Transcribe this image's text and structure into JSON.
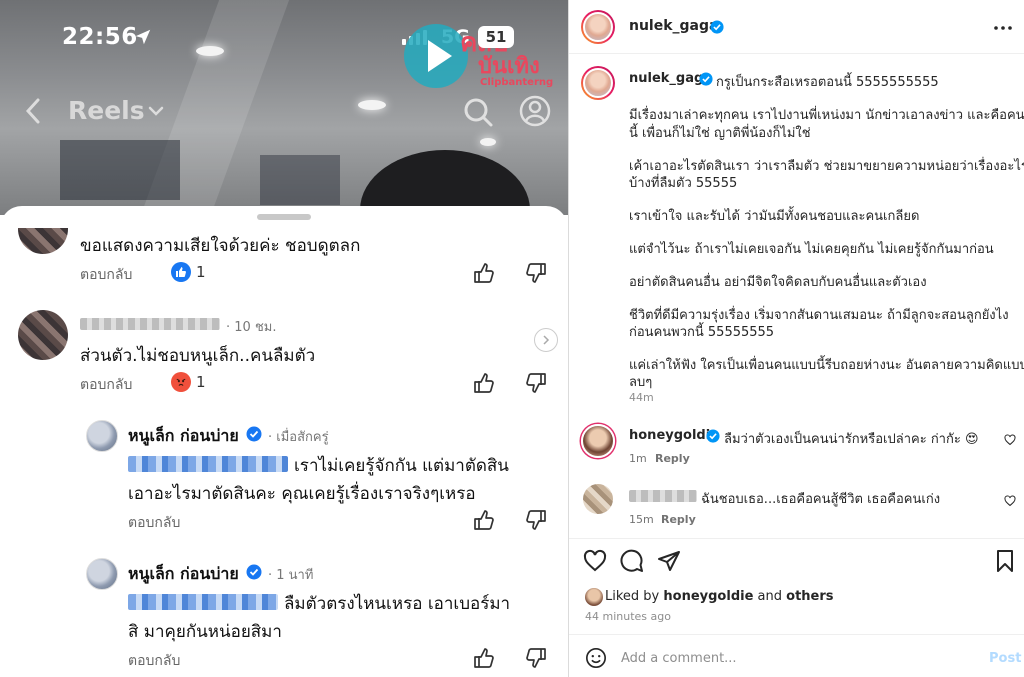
{
  "phone": {
    "status_time": "22:56",
    "network": "5G",
    "battery": "51",
    "watermark_title_1": "คลิป",
    "watermark_title_2": "บันเทิง",
    "watermark_sub": "Clipbanterng",
    "header_title": "Reels"
  },
  "comments": [
    {
      "text": "ขอแสดงความเสียใจด้วยค่ะ ชอบดูตลก",
      "reply_label": "ตอบกลับ",
      "reaction": "like",
      "reaction_count": "1"
    },
    {
      "time": "· 10 ชม.",
      "text": "ส่วนตัว.ไม่ชอบหนูเล็ก..คนลืมตัว",
      "reply_label": "ตอบกลับ",
      "reaction": "angry",
      "reaction_count": "1"
    }
  ],
  "replies": [
    {
      "name": "หนูเล็ก ก่อนบ่าย",
      "time": "· เมื่อสักครู่",
      "line1": "เราไม่เคยรู้จักกัน แต่มาตัดสิน",
      "line2": "เอาอะไรมาตัดสินคะ คุณเคยรู้เรื่องเราจริงๆเหรอ",
      "reply_label": "ตอบกลับ"
    },
    {
      "name": "หนูเล็ก ก่อนบ่าย",
      "time": "· 1 นาที",
      "line1": "ลืมตัวตรงไหนเหรอ เอาเบอร์มา",
      "line2": "สิ มาคุยกันหน่อยสิมา",
      "reply_label": "ตอบกลับ"
    }
  ],
  "post": {
    "username": "nulek_gaga",
    "caption_first": "กรูเป็นกระสือเหรอตอนนี้ 5555555555",
    "caption_lines": [
      "มีเรื่องมาเล่าคะทุกคน เราไปงานพี่เหน่งมา นักข่าวเอาลงข่าว และคือคนๆ",
      "นี้ เพื่อนก็ไม่ใช่ ญาติพี่น้องก็ไม่ใช่",
      "เค้าเอาอะไรตัดสินเรา ว่าเราลืมตัว ช่วยมาขยายความหน่อยว่าเรื่องอะไร",
      "บ้างที่ลืมตัว 55555",
      "เราเข้าใจ และรับได้ ว่ามันมีทั้งคนชอบและคนเกลียด",
      "แต่จำไว้นะ ถ้าเราไม่เคยเจอกัน ไม่เคยคุยกัน ไม่เคยรู้จักกันมาก่อน",
      "อย่าตัดสินคนอื่น อย่ามีจิตใจคิดลบกับคนอื่นและตัวเอง",
      "ชีวิตที่ดีมีความรุ่งเรื่อง เริ่มจากสันดานเสมอนะ ถ้ามีลูกจะสอนลูกยังไง",
      "ก่อนคนพวกนี้ 55555555",
      "แค่เล่าให้ฟัง ใครเป็นเพื่อนคนแบบนี้รีบถอยห่างนะ อันตลายความคิดแบบ",
      "ลบๆ"
    ],
    "caption_time": "44m",
    "comments": [
      {
        "username": "honeygoldie",
        "text": "ลืมว่าตัวเองเป็นคนน่ารักหรือเปล่าคะ ก่ากัะ 😍",
        "time": "1m",
        "reply": "Reply"
      },
      {
        "username": "",
        "text": "ฉันชอบเธอ...เธอคือคนสู้ชีวิต เธอคือคนเก่ง",
        "time": "15m",
        "reply": "Reply"
      }
    ],
    "liked_by_prefix": "Liked by ",
    "liked_by_user": "honeygoldie",
    "liked_by_and": " and ",
    "liked_by_others": "others",
    "posted_ago": "44 minutes ago",
    "add_comment_placeholder": "Add a comment...",
    "post_button": "Post"
  },
  "colors": {
    "verified": "#0095f6",
    "like_reaction": "#1877f2",
    "angry_reaction": "#f0503c",
    "post_button_disabled": "#b3dbff"
  }
}
